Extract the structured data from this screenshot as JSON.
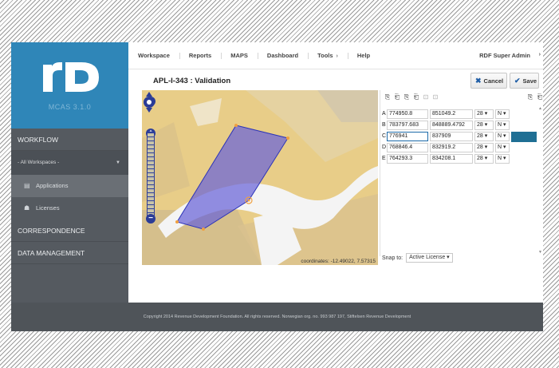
{
  "brand": {
    "logo_text": "rD",
    "version": "MCAS 3.1.0",
    "brand_color": "#2f86b8"
  },
  "sidebar": {
    "workflow": "WORKFLOW",
    "workspace_select": "- All Workspaces -",
    "items": [
      {
        "label": "Applications",
        "icon": "document-icon",
        "active": true
      },
      {
        "label": "Licenses",
        "icon": "person-icon",
        "active": false
      }
    ],
    "correspondence": "CORRESPONDENCE",
    "data_management": "DATA MANAGEMENT"
  },
  "topnav": {
    "items": [
      "Workspace",
      "Reports",
      "MAPS",
      "Dashboard",
      "Tools",
      "Help"
    ],
    "user": "RDF Super Admin"
  },
  "page": {
    "title": "APL-I-343 : Validation",
    "cancel_label": "Cancel",
    "save_label": "Save"
  },
  "map": {
    "coordinates_readout": "coordinates: -12.49022, 7.57315",
    "polygon_color": "#5f5fd6",
    "zoom_level_fraction": 0.8
  },
  "coords_table": {
    "rows": [
      {
        "id": "A",
        "easting": "774950.8",
        "northing": "851049.2",
        "zone": "28",
        "hemisphere": "N"
      },
      {
        "id": "B",
        "easting": "783797.683",
        "northing": "848889.4792",
        "zone": "28",
        "hemisphere": "N"
      },
      {
        "id": "C",
        "easting": "776941",
        "northing": "837909",
        "zone": "28",
        "hemisphere": "N"
      },
      {
        "id": "D",
        "easting": "768846.4",
        "northing": "832919.2",
        "zone": "28",
        "hemisphere": "N"
      },
      {
        "id": "E",
        "easting": "764293.3",
        "northing": "834208.1",
        "zone": "28",
        "hemisphere": "N"
      }
    ],
    "selected_row": "C"
  },
  "snap": {
    "label": "Snap to:",
    "value": "Active License"
  },
  "footer": {
    "text": "Copyright 2014 Revenue Development Foundation. All rights reserved. Norwegian org. no. 993 987 197, Stiftelsen Revenue Development"
  }
}
